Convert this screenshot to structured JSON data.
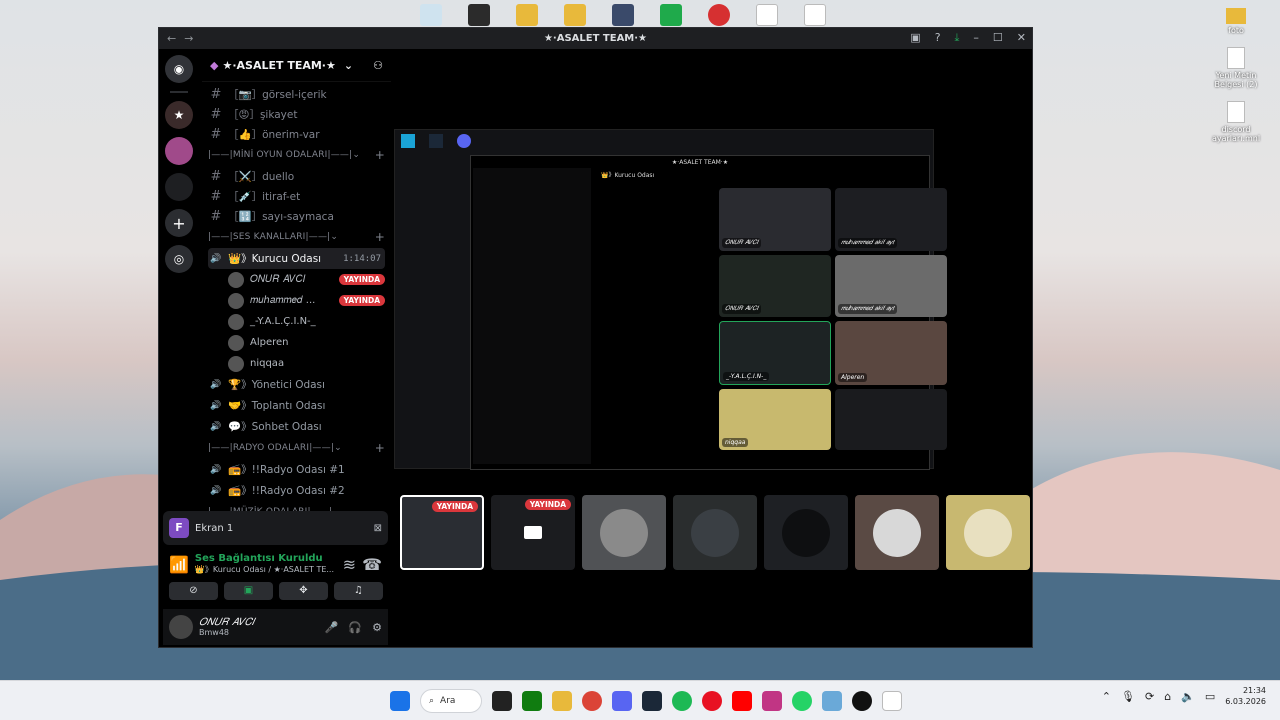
{
  "desktop": {
    "right_icons": [
      {
        "label": "foto"
      },
      {
        "label": "Yeni Metin Belgesi (2)"
      },
      {
        "label": "discord ayarları.mnl"
      }
    ]
  },
  "window": {
    "title": "★·ASALET TEAM·★",
    "back": "←",
    "forward": "→",
    "minimize": "–",
    "maximize": "☐",
    "close": "✕"
  },
  "server": {
    "name": "★·ASALET TEAM·★",
    "channels": [
      {
        "name": "［📷］görsel-içerik"
      },
      {
        "name": "［😡］şikayet"
      },
      {
        "name": "［👍］önerim-var"
      }
    ],
    "cat_minigames": "|——|MİNİ OYUN ODALARI|——|",
    "mini_channels": [
      {
        "name": "［⚔️］duello"
      },
      {
        "name": "［💉］itiraf-et"
      },
      {
        "name": "［🔢］sayı-saymaca"
      }
    ],
    "cat_voice": "|——|SES KANALLARI|——|",
    "active_voice": {
      "name": "👑》Kurucu Odası",
      "time": "1:14:07"
    },
    "voice_users": [
      {
        "name": "𝑂𝑁𝑈𝑅 𝐴𝑉𝐶𝐼",
        "live": "YAYINDA"
      },
      {
        "name": "𝑚𝑢ℎ𝑎𝑚𝑚𝑒𝑑 ...",
        "live": "YAYINDA"
      },
      {
        "name": "_-Y.A.L.Ç.I.N-_",
        "live": ""
      },
      {
        "name": "Alperen",
        "live": ""
      },
      {
        "name": "niqqaa",
        "live": ""
      }
    ],
    "voice_channels": [
      {
        "name": "🏆》Yönetici Odası"
      },
      {
        "name": "🤝》Toplantı Odası"
      },
      {
        "name": "💬》Sohbet Odası"
      }
    ],
    "cat_radio": "|——|RADYO ODALARI|——|",
    "radio_channels": [
      {
        "name": "📻》!!Radyo Odası #1"
      },
      {
        "name": "📻》!!Radyo Odası #2"
      }
    ],
    "cat_music": "|——|MÜZİK ODALARI|——|"
  },
  "voice_panel": {
    "screen_label": "Ekran 1",
    "screen_letter": "F",
    "status": "Ses Bağlantısı Kuruldu",
    "location": "👑》Kurucu Odası / ★·ASALET TE..."
  },
  "user": {
    "name": "𝑂𝑁𝑈𝑅 𝐴𝑉𝐶𝐼",
    "status": "Bmw48"
  },
  "stage": {
    "inner_title": "★·ASALET TEAM·★",
    "inner_channel": "👑》Kurucu Odası",
    "tiles": [
      {
        "label": "𝑂𝑁𝑈𝑅 𝐴𝑉𝐶𝐼",
        "color": "#2a2b30"
      },
      {
        "label": "𝑚𝑢ℎ𝑎𝑚𝑚𝑒𝑑 𝑎𝑘𝑖𝑓 𝑎𝑦𝑡",
        "color": "#1d1e22"
      },
      {
        "label": "𝑂𝑁𝑈𝑅 𝐴𝑉𝐶𝐼",
        "color": "#1f2622"
      },
      {
        "label": "𝑚𝑢ℎ𝑎𝑚𝑚𝑒𝑑 𝑎𝑘𝑖𝑓 𝑎𝑦𝑡",
        "color": "#6b6b6b"
      },
      {
        "label": "_-Y.A.L.Ç.I.N-_",
        "color": "#1d2324"
      },
      {
        "label": "Alperen",
        "color": "#5a4740"
      },
      {
        "label": "niqqaa",
        "color": "#c8b96e"
      },
      {
        "label": "",
        "color": "#1a1b1e"
      }
    ]
  },
  "strip": {
    "live_label": "YAYINDA",
    "thumbs": [
      {
        "color": "#2a2d33",
        "live": true
      },
      {
        "color": "#1b1c1f",
        "live": true
      },
      {
        "color": "#505255",
        "live": false
      },
      {
        "color": "#2a2d2e",
        "live": false
      },
      {
        "color": "#1e2024",
        "live": false
      },
      {
        "color": "#5a4a44",
        "live": false
      },
      {
        "color": "#c8b870",
        "live": false
      }
    ]
  },
  "taskbar": {
    "search": "Ara",
    "time": "21:34",
    "date": "6.03.2026"
  },
  "colors": {
    "live": "#da373c",
    "connected": "#23a55a",
    "accent": "#5865f2"
  }
}
